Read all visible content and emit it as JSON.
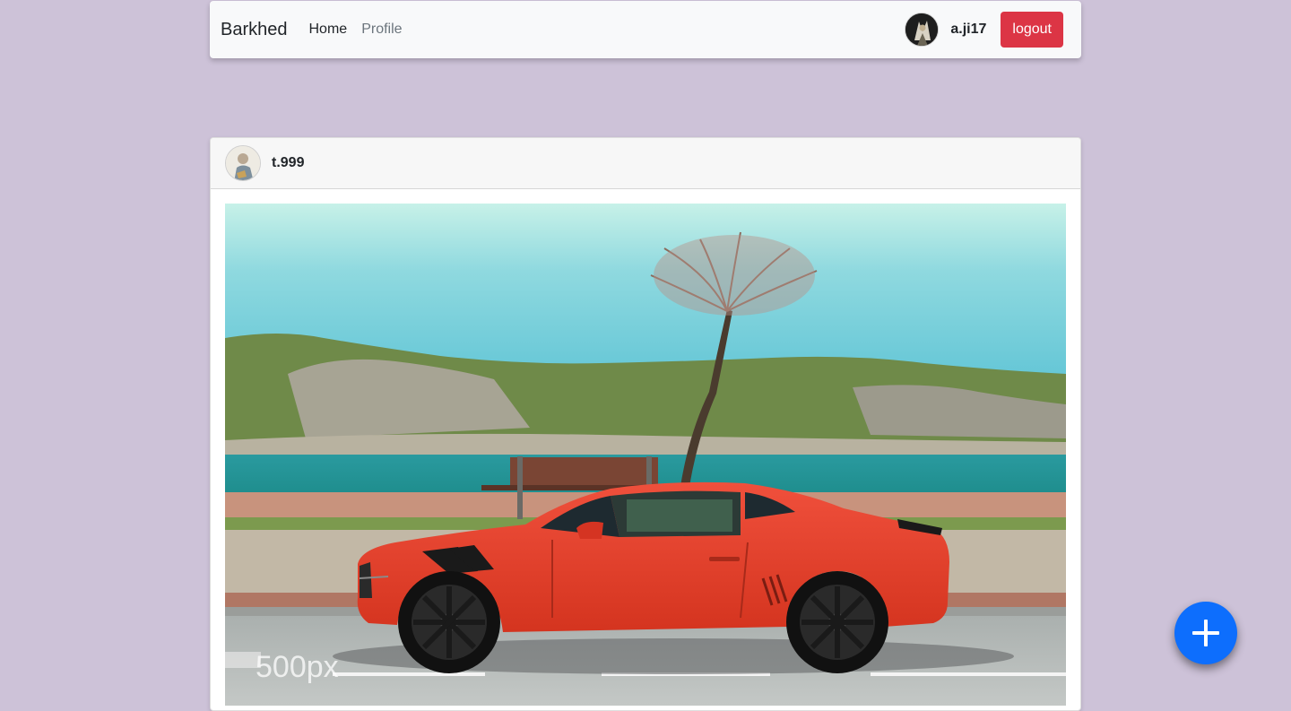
{
  "navbar": {
    "brand": "Barkhed",
    "links": [
      {
        "label": "Home"
      },
      {
        "label": "Profile"
      }
    ],
    "user": {
      "username": "a.ji17"
    },
    "logout_label": "logout"
  },
  "post": {
    "username": "t.999",
    "watermark": "500px"
  },
  "fab": {
    "icon": "plus-icon"
  },
  "colors": {
    "background": "#cdc2d8",
    "logout": "#dc3545",
    "fab": "#0d6efd",
    "car": "#e8402f"
  }
}
